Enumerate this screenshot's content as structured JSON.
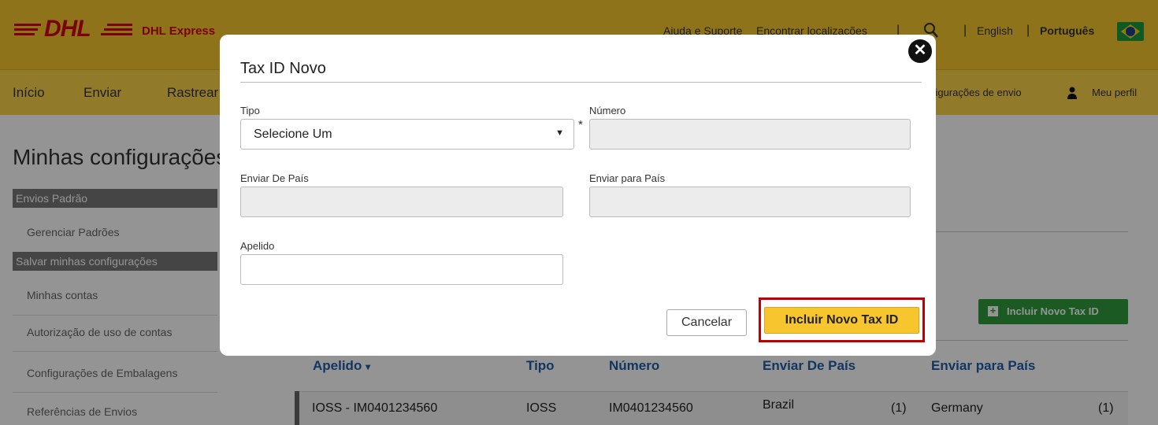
{
  "header": {
    "logo_text": "DHL",
    "brand": "DHL Express",
    "help": "Ajuda e Suporte",
    "locations": "Encontrar localizações",
    "lang_english": "English",
    "lang_portuguese": "Português"
  },
  "nav": {
    "inicio": "Início",
    "enviar": "Enviar",
    "rastrear": "Rastrear",
    "config_envio": "Configurações de envio",
    "perfil": "Meu perfil"
  },
  "page": {
    "title": "Minhas configurações"
  },
  "sidebar": {
    "section1": "Envios Padrão",
    "link1": "Gerenciar Padrões",
    "section2": "Salvar minhas configurações",
    "link2": "Minhas contas",
    "link3": "Autorização de uso de contas",
    "link4": "Configurações de Embalagens",
    "link5": "Referências de Envios"
  },
  "content": {
    "add_button": "Incluir Novo Tax ID",
    "table": {
      "headers": [
        "Apelido",
        "Tipo",
        "Número",
        "Enviar De País",
        "Enviar para País"
      ],
      "sort_indicator": "▾",
      "rows": [
        {
          "apelido": "IOSS - IM0401234560",
          "tipo": "IOSS",
          "numero": "IM0401234560",
          "de_pais": "Brazil",
          "de_count": "(1)",
          "para_pais": "Germany",
          "para_count": "(1)"
        }
      ]
    }
  },
  "modal": {
    "title": "Tax ID Novo",
    "tipo_label": "Tipo",
    "tipo_value": "Selecione Um",
    "numero_label": "Número",
    "required_mark": "*",
    "de_pais_label": "Enviar De País",
    "para_pais_label": "Enviar para País",
    "apelido_label": "Apelido",
    "numero_value": "",
    "de_pais_value": "",
    "para_pais_value": "",
    "apelido_value": "",
    "cancel": "Cancelar",
    "submit": "Incluir Novo Tax ID",
    "close_glyph": "✕"
  },
  "colors": {
    "dhl_yellow": "#f7c62f",
    "dhl_red": "#d40511",
    "link_blue": "#1f5ea8",
    "add_green": "#2f9e3d",
    "highlight_red": "#c00000"
  }
}
